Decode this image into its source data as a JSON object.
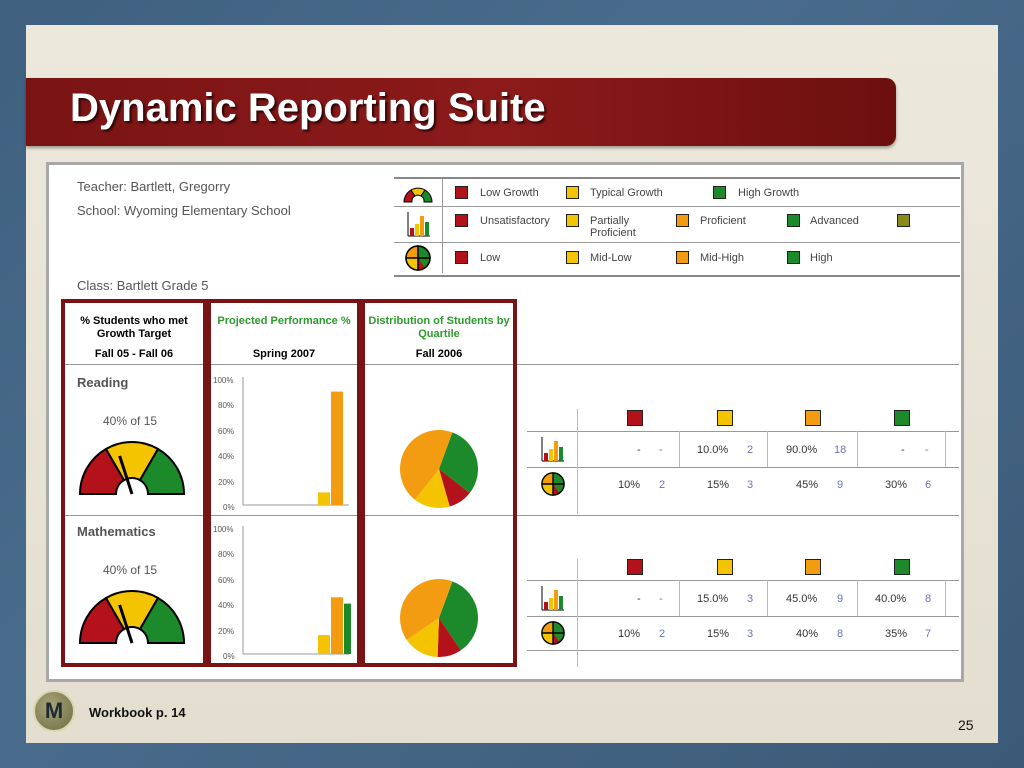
{
  "slide": {
    "title": "Dynamic Reporting Suite",
    "footer_text": "Workbook p. 14",
    "logo_letter": "M",
    "page_number": "25"
  },
  "report": {
    "teacher": "Teacher: Bartlett, Gregorry",
    "school": "School:  Wyoming Elementary School",
    "class": "Class: Bartlett Grade 5",
    "legend": {
      "growth": [
        "Low Growth",
        "Typical Growth",
        "High Growth"
      ],
      "performance": [
        "Unsatisfactory",
        "Partially Proficient",
        "Proficient",
        "Advanced"
      ],
      "quartile": [
        "Low",
        "Mid-Low",
        "Mid-High",
        "High"
      ]
    },
    "columns": [
      {
        "title": "% Students who met Growth Target",
        "period": "Fall 05 - Fall 06",
        "color": "#000000"
      },
      {
        "title": "Projected Performance %",
        "period": "Spring 2007",
        "color": "#2e9b2e"
      },
      {
        "title": "Distribution of Students by Quartile",
        "period": "Fall 2006",
        "color": "#2e9b2e"
      }
    ],
    "y_ticks": [
      "100%",
      "80%",
      "60%",
      "40%",
      "20%",
      "0%"
    ],
    "subjects": [
      {
        "name": "Reading",
        "growth_text": "40% of 15",
        "growth_pct": 0.4,
        "performance_bars": [
          0,
          10,
          90,
          0
        ],
        "quartile_pie": [
          10,
          15,
          45,
          30
        ],
        "perf_row": [
          {
            "pct": "-",
            "n": "-"
          },
          {
            "pct": "10.0%",
            "n": "2"
          },
          {
            "pct": "90.0%",
            "n": "18"
          },
          {
            "pct": "-",
            "n": "-"
          }
        ],
        "quart_row": [
          {
            "pct": "10%",
            "n": "2"
          },
          {
            "pct": "15%",
            "n": "3"
          },
          {
            "pct": "45%",
            "n": "9"
          },
          {
            "pct": "30%",
            "n": "6"
          }
        ]
      },
      {
        "name": "Mathematics",
        "growth_text": "40% of 15",
        "growth_pct": 0.4,
        "performance_bars": [
          0,
          15,
          45,
          40
        ],
        "quartile_pie": [
          10,
          15,
          40,
          35
        ],
        "perf_row": [
          {
            "pct": "-",
            "n": "-"
          },
          {
            "pct": "15.0%",
            "n": "3"
          },
          {
            "pct": "45.0%",
            "n": "9"
          },
          {
            "pct": "40.0%",
            "n": "8"
          }
        ],
        "quart_row": [
          {
            "pct": "10%",
            "n": "2"
          },
          {
            "pct": "15%",
            "n": "3"
          },
          {
            "pct": "40%",
            "n": "8"
          },
          {
            "pct": "35%",
            "n": "7"
          }
        ]
      }
    ],
    "colors": {
      "red": "#b3121a",
      "yellow": "#f5c400",
      "orange": "#f39c12",
      "green": "#1c8a2a",
      "olive": "#8a8a18",
      "frame": "#7a1414"
    }
  }
}
